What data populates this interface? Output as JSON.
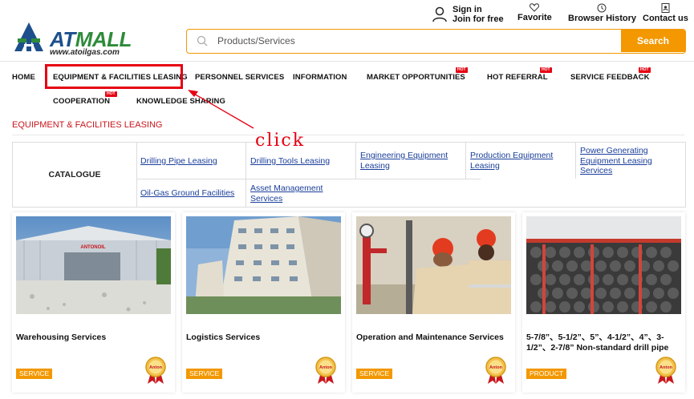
{
  "header": {
    "logo_text_a": "AT",
    "logo_text_b": "MALL",
    "logo_url": "www.atoilgas.com",
    "sign_in": "Sign in",
    "join_free": "Join for free",
    "favorite": "Favorite",
    "browser_history": "Browser History",
    "contact_us": "Contact us"
  },
  "search": {
    "placeholder": "Products/Services",
    "button": "Search"
  },
  "nav": {
    "items": [
      {
        "label": "HOME"
      },
      {
        "label": "EQUIPMENT & FACILITIES LEASING"
      },
      {
        "label": "PERSONNEL SERVICES"
      },
      {
        "label": "INFORMATION"
      },
      {
        "label": "MARKET OPPORTUNITIES"
      },
      {
        "label": "HOT REFERRAL"
      },
      {
        "label": "SERVICE FEEDBACK"
      },
      {
        "label": "COOPERATION"
      },
      {
        "label": "KNOWLEDGE SHARING"
      }
    ],
    "hot_label": "HOT"
  },
  "annotation": {
    "click": "click"
  },
  "section": {
    "title": "EQUIPMENT & FACILITIES LEASING"
  },
  "catalogue": {
    "label": "CATALOGUE",
    "items": [
      "Drilling Pipe Leasing",
      "Drilling Tools Leasing",
      "Engineering Equipment Leasing",
      "Production Equipment Leasing",
      "Power Generating Equipment Leasing Services",
      "Oil-Gas Ground Facilities",
      "Asset Management Services"
    ]
  },
  "cards": [
    {
      "title": "Warehousing Services",
      "tag": "SERVICE",
      "image": "warehouse-photo",
      "sign": "ANTONOIL"
    },
    {
      "title": "Logistics Services",
      "tag": "SERVICE",
      "image": "building-photo"
    },
    {
      "title": "Operation and Maintenance Services",
      "tag": "SERVICE",
      "image": "workers-photo"
    },
    {
      "title": "5-7/8”、5-1/2”、5”、4-1/2”、4”、3-1/2”、2-7/8” Non-standard drill pipe",
      "tag": "PRODUCT",
      "image": "drill-pipe-photo"
    }
  ],
  "badge_text": "Anton",
  "colors": {
    "brand_blue": "#1d4f8c",
    "brand_green": "#2e8b3a",
    "accent_orange": "#f39800",
    "highlight_red": "#e60012",
    "link_blue": "#1a3e9a"
  }
}
